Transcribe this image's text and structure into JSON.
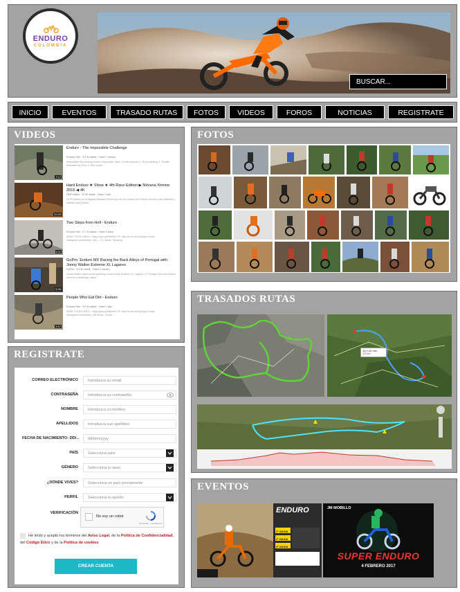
{
  "header": {
    "logo_text": "ENDURO",
    "logo_sub": "COLOMBIA",
    "search_label": "BUSCAR..."
  },
  "nav": {
    "items": [
      "INICIO",
      "EVENTOS",
      "TRASADO RUTAS",
      "FOTOS",
      "VIDEOS",
      "FOROS",
      "NOTICIAS",
      "REGISTRATE"
    ]
  },
  "videos": {
    "title": "VIDEOS",
    "items": [
      {
        "title": "Enduro - The Impossible Challenge",
        "meta": "Enduro Hell · 3,4 M vistas · Hace 7 meses",
        "desc": "Impossible Hill-climbing Enduro Impossible Skills | In this episode: 1. Rock climbing 2. Throttle Activation by Dodo 3. Bike crash",
        "duration": "7:17"
      },
      {
        "title": "Hard Enduro ★ Show ★ 4th Race Edition ▶ Nirvana Xtreme 2016 ◀ 4K",
        "meta": "FiloPowilks · 10 M vistas · Hace 1 año",
        "desc": "La 4ª Edición de la llegada Nirvana Xtreme que es una carrera de enduro extremo para valientes y también para pilotos",
        "duration": "12:09"
      },
      {
        "title": "Two Steps from Hell - Enduro",
        "meta": "Enduro Hell · 5,7 M vistas · Hace 2 años",
        "desc": "SEND YOUR VIDEO > https://goo.gl/W8dHm FB: http://on.fb.me/1pKIgmZ Insta: instagram.com/enduro_hell — CC Music: Templing",
        "duration": "4:11"
      },
      {
        "title": "GoPro: Enduro MX Racing the Back Alleys of Portugal with Jonny Walker Extreme XL Lagares",
        "meta": "GoPro · 6,4 M vistas · Hace 3 meses",
        "desc": "Jonny Walker takes on the grueling course of the Extreme XL Lagares, in Portugal. Not one to back down to a challenge, follow",
        "duration": "5:26"
      },
      {
        "title": "People Who Eat Dirt - Enduro",
        "meta": "Enduro Hell · 4,4 M vistas · Hace 1 año",
        "desc": "SEND YOUR VIDEO > https://goo.gl/W8dHm FB: http://on.fb.me/1pKIgmZ Insta: instagram.com/enduro_hell Music: Cruise",
        "duration": "3:57"
      }
    ]
  },
  "registro": {
    "title": "REGISTRATE",
    "fields": [
      {
        "label": "CORREO ELECTRÓNICO",
        "placeholder": "Introduzca su email",
        "type": "text"
      },
      {
        "label": "CONTRASEÑA",
        "placeholder": "Introduzca su contraseña",
        "type": "password"
      },
      {
        "label": "NOMBRE",
        "placeholder": "Introduzca su nombre",
        "type": "text"
      },
      {
        "label": "APELLIDOS",
        "placeholder": "Introduzca sus apellidos",
        "type": "text"
      },
      {
        "label": "FECHA DE NACIMIENTO: DD/...",
        "placeholder": "dd/mm/yyyy",
        "type": "text"
      },
      {
        "label": "PAÍS",
        "placeholder": "Selecciona país",
        "type": "select"
      },
      {
        "label": "GÉNERO",
        "placeholder": "Selecciona tu sexo",
        "type": "select"
      },
      {
        "label": "¿DÓNDE VIVES?",
        "placeholder": "Selecciona un país previamente",
        "type": "text"
      },
      {
        "label": "PERFIL",
        "placeholder": "Selecciona tu opción",
        "type": "select"
      }
    ],
    "verification_label": "VERIFICACIÓN",
    "captcha_label": "No soy un robot",
    "captcha_privacy": "Privacidad · Condiciones",
    "terms": {
      "t1": "He leído y acepto los términos del ",
      "l1": "Aviso Legal",
      "t2": ", de la ",
      "l2": "Política de Confidencialidad",
      "t3": ", del ",
      "l3": "Código Ético",
      "t4": " y de la ",
      "l4": "Política de cookies"
    },
    "submit_label": "CREAR CUENTA"
  },
  "fotos": {
    "title": "FOTOS"
  },
  "rutas": {
    "title": "TRASADOS RUTAS",
    "map2_label": "10 h 42 min",
    "map2_sub": "333 km"
  },
  "eventos": {
    "title": "EVENTOS",
    "ev1_title": "ENDURO",
    "ev1_lines": [
      "1ª VALIDA",
      "2ª VALIDA",
      "3ª VALIDA"
    ],
    "ev2_top": "JM MOBILLO",
    "ev2_title": "SUPER ENDURO",
    "ev2_date": "4 FEBRERO 2017"
  },
  "colors": {
    "panel_bg": "#a3a3a3",
    "nav_bg": "#000000",
    "accent_button": "#1fb8c8",
    "link_red": "#c2171d"
  }
}
